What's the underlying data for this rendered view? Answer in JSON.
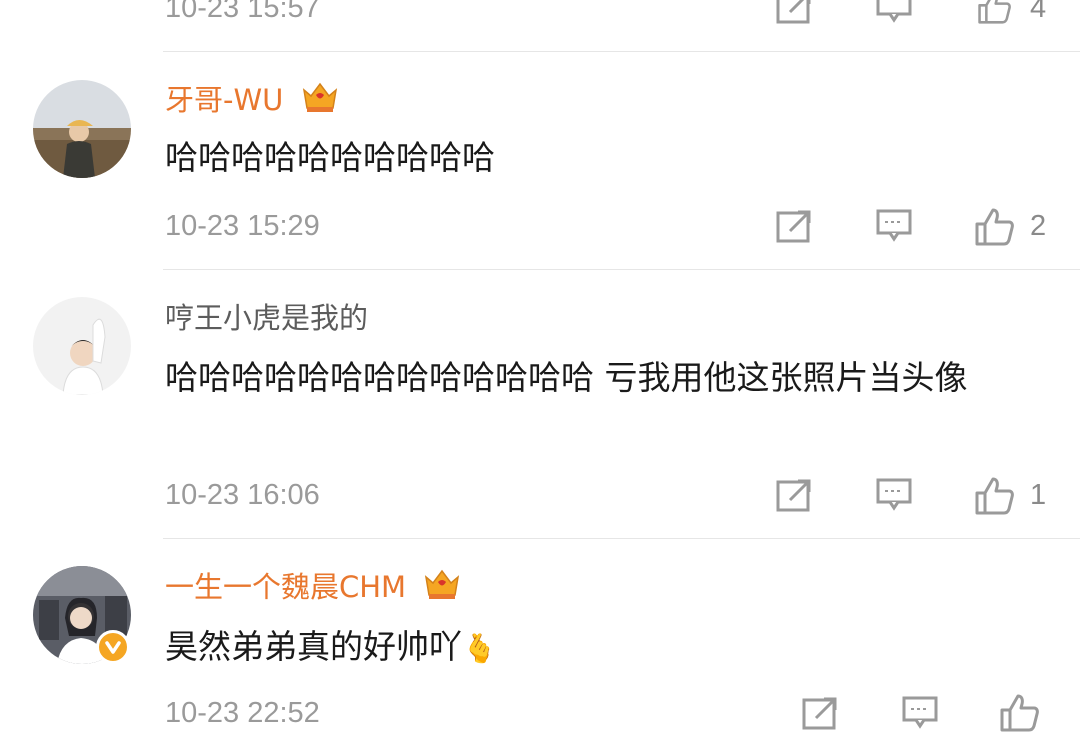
{
  "comments": [
    {
      "username": "",
      "text": "",
      "time": "10-23 15:57",
      "like_count": "4"
    },
    {
      "username": "牙哥-WU",
      "text": "哈哈哈哈哈哈哈哈哈哈",
      "time": "10-23 15:29",
      "like_count": "2",
      "vip": true
    },
    {
      "username": "哼王小虎是我的",
      "text": "哈哈哈哈哈哈哈哈哈哈哈哈哈 亏我用他这张照片当头像",
      "time": "10-23 16:06",
      "like_count": "1",
      "vip": false
    },
    {
      "username": "一生一个魏晨CHM",
      "text": "昊然弟弟真的好帅吖",
      "emoji": "🫰",
      "time": "10-23 22:52",
      "like_count": "",
      "vip": true,
      "verified": true
    }
  ],
  "icons": {
    "share": "share-icon",
    "comment": "comment-icon",
    "like": "thumbs-up-icon",
    "vip_crown": "vip-crown-icon",
    "verified": "verified-badge-icon"
  },
  "colors": {
    "vip_name": "#e8772e",
    "normal_name": "#5c5c5c",
    "timestamp": "#9a9a9a",
    "icon": "#9a9a9a",
    "crown": "#f5a623"
  }
}
